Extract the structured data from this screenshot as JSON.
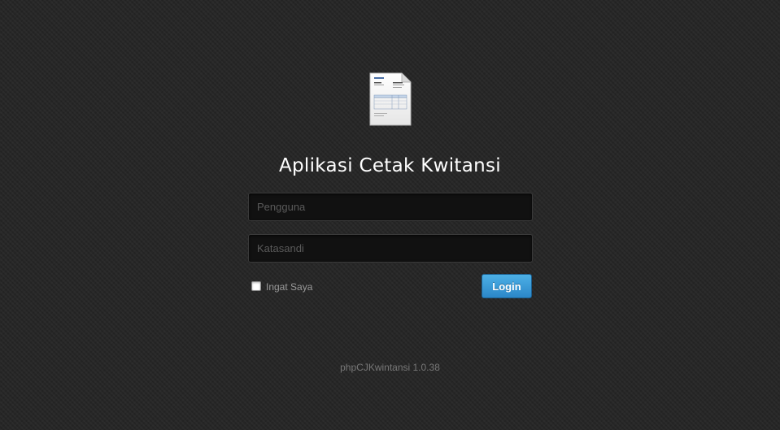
{
  "app": {
    "title": "Aplikasi Cetak Kwitansi",
    "logo_icon": "invoice-document-icon"
  },
  "login": {
    "username_placeholder": "Pengguna",
    "username_value": "",
    "password_placeholder": "Katasandi",
    "password_value": "",
    "remember_label": "Ingat Saya",
    "remember_checked": false,
    "submit_label": "Login"
  },
  "footer": {
    "version": "phpCJKwintansi 1.0.38"
  },
  "colors": {
    "background": "#262626",
    "button": "#2b87c8",
    "title": "#ffffff"
  }
}
